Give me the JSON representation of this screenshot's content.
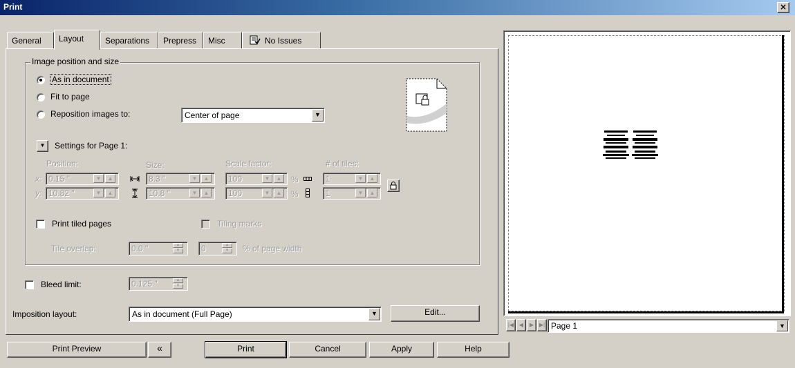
{
  "window": {
    "title": "Print",
    "close_glyph": "×"
  },
  "tabs": [
    {
      "label": "General"
    },
    {
      "label": "Layout"
    },
    {
      "label": "Separations"
    },
    {
      "label": "Prepress"
    },
    {
      "label": "Misc"
    },
    {
      "label": "No Issues",
      "icon": "checklist-icon"
    }
  ],
  "position_group": {
    "title": "Image position and size",
    "options": {
      "as_in_document": "As in document",
      "fit_to_page": "Fit to page",
      "reposition": "Reposition images to:"
    },
    "selected": "as_in_document",
    "reposition_value": "Center of page"
  },
  "settings": {
    "toggle_label": "Settings for Page 1:",
    "headers": {
      "position": "Position:",
      "size": "Size:",
      "scale": "Scale factor:",
      "tiles": "# of tiles:"
    },
    "x_label": "x:",
    "y_label": "y:",
    "pos_x": "0.15 \"",
    "pos_y": "10.82 \"",
    "size_w": "8.3 \"",
    "size_h": "10.8 \"",
    "scale_x": "100",
    "scale_y": "100",
    "percent": "%",
    "tiles_x": "1",
    "tiles_y": "1"
  },
  "tiling": {
    "print_tiled": "Print tiled pages",
    "tiling_marks": "Tiling marks",
    "tile_overlap_label": "Tile overlap:",
    "tile_overlap_value": "0.0 \"",
    "percent_value": "0",
    "percent_label": "% of page width"
  },
  "bleed": {
    "label": "Bleed limit:",
    "value": "0.125 \""
  },
  "imposition": {
    "label": "Imposition layout:",
    "value": "As in document (Full Page)",
    "edit_button": "Edit..."
  },
  "preview": {
    "page_label": "Page 1"
  },
  "buttons": {
    "print_preview": "Print Preview",
    "collapse_glyph": "«",
    "print": "Print",
    "cancel": "Cancel",
    "apply": "Apply",
    "help": "Help"
  }
}
